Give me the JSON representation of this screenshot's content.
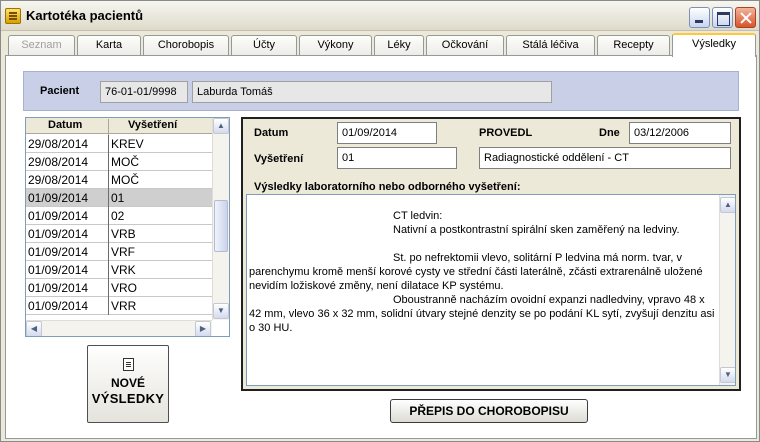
{
  "window": {
    "title": "Kartotéka pacientů"
  },
  "tabs": [
    {
      "label": "Seznam",
      "state": "disabled"
    },
    {
      "label": "Karta",
      "state": "normal"
    },
    {
      "label": "Chorobopis",
      "state": "normal"
    },
    {
      "label": "Účty",
      "state": "normal"
    },
    {
      "label": "Výkony",
      "state": "normal"
    },
    {
      "label": "Léky",
      "state": "normal"
    },
    {
      "label": "Očkování",
      "state": "normal"
    },
    {
      "label": "Stálá léčiva",
      "state": "normal"
    },
    {
      "label": "Recepty",
      "state": "normal"
    },
    {
      "label": "Výsledky",
      "state": "active"
    }
  ],
  "patient": {
    "label": "Pacient",
    "id": "76-01-01/9998",
    "name": "Laburda Tomáš"
  },
  "list": {
    "headers": {
      "date": "Datum",
      "exam": "Vyšetření"
    },
    "rows": [
      {
        "date": "29/08/2014",
        "exam": "KREV"
      },
      {
        "date": "29/08/2014",
        "exam": "MOČ"
      },
      {
        "date": "29/08/2014",
        "exam": "MOČ"
      },
      {
        "date": "01/09/2014",
        "exam": "01",
        "selected": true
      },
      {
        "date": "01/09/2014",
        "exam": "02"
      },
      {
        "date": "01/09/2014",
        "exam": "VRB"
      },
      {
        "date": "01/09/2014",
        "exam": "VRF"
      },
      {
        "date": "01/09/2014",
        "exam": "VRK"
      },
      {
        "date": "01/09/2014",
        "exam": "VRO"
      },
      {
        "date": "01/09/2014",
        "exam": "VRR"
      }
    ]
  },
  "buttons": {
    "new_results_line1": "NOVÉ",
    "new_results_line2": "VÝSLEDKY",
    "rewrite": "PŘEPIS DO CHOROBOPISU"
  },
  "detail": {
    "date_label": "Datum",
    "date_value": "01/09/2014",
    "performed_label": "PROVEDL",
    "day_label": "Dne",
    "day_value": "03/12/2006",
    "exam_label": "Vyšetření",
    "exam_value": "01",
    "department": "Radiagnostické oddělení - CT",
    "results_label": "Výsledky laboratorního nebo odborného vyšetření:",
    "text_lines": [
      "CT ledvin:",
      "Nativní a postkontrastní spirální sken zaměřený na ledviny.",
      "St. po nefrektomii vlevo, solitární P ledvina má norm. tvar, v",
      "parenchymu kromě menší korové cysty ve střední části laterálně, zčásti extrarenálně uložené",
      "nevidím ložiskové změny, není dilatace KP systému.",
      "Oboustranně nacházím ovoidní expanzi nadledviny, vpravo 48 x",
      "42 mm, vlevo 36 x 32 mm, solidní útvary stejné denzity se po podání KL sytí, zvyšují denzitu asi",
      "o 30 HU."
    ]
  }
}
